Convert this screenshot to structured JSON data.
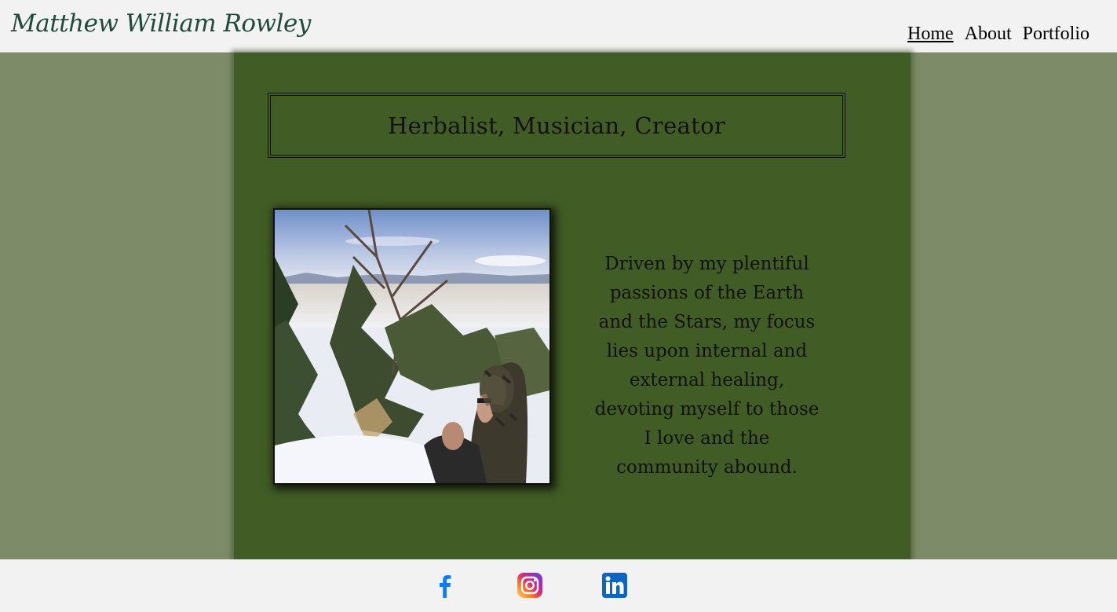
{
  "header": {
    "site_title": "Matthew William Rowley",
    "nav": [
      {
        "label": "Home",
        "active": true
      },
      {
        "label": "About",
        "active": false
      },
      {
        "label": "Portfolio",
        "active": false
      }
    ]
  },
  "main": {
    "tagline": "Herbalist, Musician, Creator",
    "photo": {
      "description_icon": "profile-photo"
    },
    "bio": "Driven by my plentiful passions of the Earth and the Stars, my focus lies upon internal and external healing, devoting myself to those I love and the community abound."
  },
  "footer": {
    "social": [
      {
        "icon": "facebook-icon",
        "color": "#1877f2"
      },
      {
        "icon": "instagram-icon",
        "color": "#e1306c"
      },
      {
        "icon": "linkedin-icon",
        "color": "#0a66c2"
      }
    ]
  },
  "colors": {
    "header_bg": "#f2f2f2",
    "page_bg": "#7d8b68",
    "panel_bg": "#425c25",
    "title_color": "#1f4a3c"
  }
}
